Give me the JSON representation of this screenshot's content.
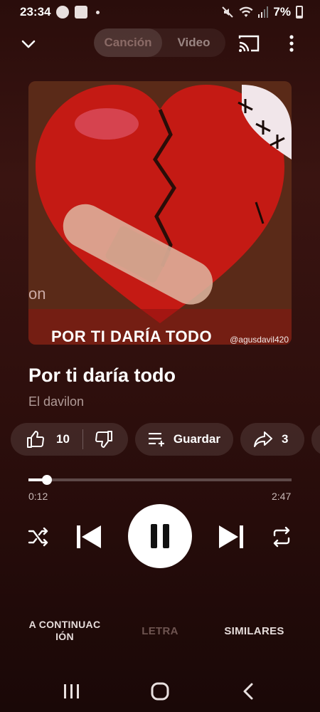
{
  "status": {
    "time": "23:34",
    "battery": "7%"
  },
  "tabs_toggle": {
    "song": "Canción",
    "video": "Video"
  },
  "artwork": {
    "caption": "POR TI DARÍA TODO",
    "watermark": "@agusdavil420",
    "side_text": "on"
  },
  "track": {
    "title": "Por ti daría todo",
    "artist": "El davilon"
  },
  "actions": {
    "likes": "10",
    "save_label": "Guardar",
    "shares": "3"
  },
  "playback": {
    "current": "0:12",
    "total": "2:47",
    "progress_fraction": 0.07
  },
  "bottom_tabs": {
    "queue": "A CONTINUAC IÓN",
    "lyrics": "LETRA",
    "related": "SIMILARES"
  },
  "colors": {
    "background": "#2a0d0b",
    "accent": "#ffffff",
    "muted_text": "#b09a97"
  }
}
